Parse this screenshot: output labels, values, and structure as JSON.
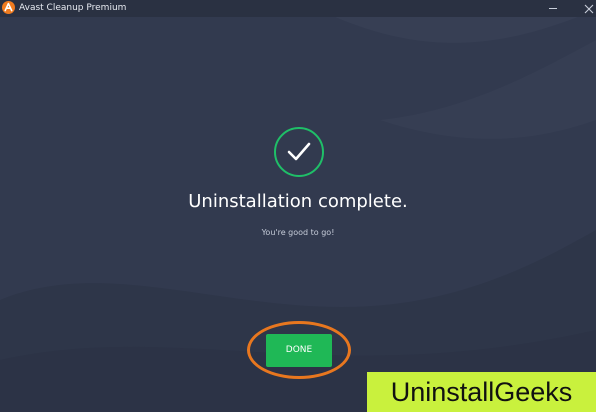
{
  "window": {
    "title": "Avast Cleanup Premium",
    "icons": {
      "app_logo": "avast-logo-icon",
      "minimize": "minimize-icon",
      "close": "close-icon"
    }
  },
  "main": {
    "status_icon": "checkmark-circle-icon",
    "heading": "Uninstallation complete.",
    "subtext": "You're good to go!",
    "done_button_label": "DONE"
  },
  "annotation": {
    "highlight": "orange-circle-highlight"
  },
  "watermark": {
    "text": "UninstallGeeks"
  },
  "colors": {
    "background": "#323a4f",
    "titlebar": "#2a3142",
    "accent_green": "#1fb856",
    "check_green": "#1fbf68",
    "highlight_orange": "#e8771f",
    "watermark_bg": "#c9f13d",
    "avast_orange": "#f07b1f"
  }
}
